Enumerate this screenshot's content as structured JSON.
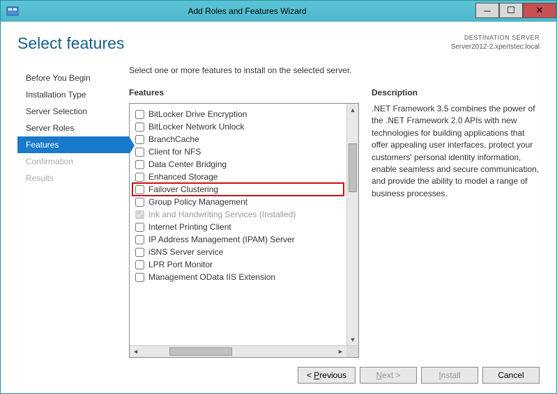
{
  "titlebar": {
    "title": "Add Roles and Features Wizard"
  },
  "header": {
    "heading": "Select features",
    "dest_label": "DESTINATION SERVER",
    "dest_server": "Server2012-2.xpertstec.local"
  },
  "nav": {
    "items": [
      {
        "label": "Before You Begin",
        "active": false,
        "disabled": false
      },
      {
        "label": "Installation Type",
        "active": false,
        "disabled": false
      },
      {
        "label": "Server Selection",
        "active": false,
        "disabled": false
      },
      {
        "label": "Server Roles",
        "active": false,
        "disabled": false
      },
      {
        "label": "Features",
        "active": true,
        "disabled": false
      },
      {
        "label": "Confirmation",
        "active": false,
        "disabled": true
      },
      {
        "label": "Results",
        "active": false,
        "disabled": true
      }
    ]
  },
  "main": {
    "instruction": "Select one or more features to install on the selected server.",
    "features_label": "Features",
    "description_label": "Description",
    "description_text": ".NET Framework 3.5 combines the power of the .NET Framework 2.0 APIs with new technologies for building applications that offer appealing user interfaces, protect your customers' personal identity information, enable seamless and secure communication, and provide the ability to model a range of business processes.",
    "features": [
      {
        "label": "BitLocker Drive Encryption",
        "checked": false,
        "disabled": false,
        "highlighted": false
      },
      {
        "label": "BitLocker Network Unlock",
        "checked": false,
        "disabled": false,
        "highlighted": false
      },
      {
        "label": "BranchCache",
        "checked": false,
        "disabled": false,
        "highlighted": false
      },
      {
        "label": "Client for NFS",
        "checked": false,
        "disabled": false,
        "highlighted": false
      },
      {
        "label": "Data Center Bridging",
        "checked": false,
        "disabled": false,
        "highlighted": false
      },
      {
        "label": "Enhanced Storage",
        "checked": false,
        "disabled": false,
        "highlighted": false
      },
      {
        "label": "Failover Clustering",
        "checked": false,
        "disabled": false,
        "highlighted": true
      },
      {
        "label": "Group Policy Management",
        "checked": false,
        "disabled": false,
        "highlighted": false
      },
      {
        "label": "Ink and Handwriting Services (Installed)",
        "checked": true,
        "disabled": true,
        "highlighted": false
      },
      {
        "label": "Internet Printing Client",
        "checked": false,
        "disabled": false,
        "highlighted": false
      },
      {
        "label": "IP Address Management (IPAM) Server",
        "checked": false,
        "disabled": false,
        "highlighted": false
      },
      {
        "label": "iSNS Server service",
        "checked": false,
        "disabled": false,
        "highlighted": false
      },
      {
        "label": "LPR Port Monitor",
        "checked": false,
        "disabled": false,
        "highlighted": false
      },
      {
        "label": "Management OData IIS Extension",
        "checked": false,
        "disabled": false,
        "highlighted": false
      }
    ]
  },
  "buttons": {
    "previous": "< Previous",
    "next": "Next >",
    "install": "Install",
    "cancel": "Cancel"
  }
}
